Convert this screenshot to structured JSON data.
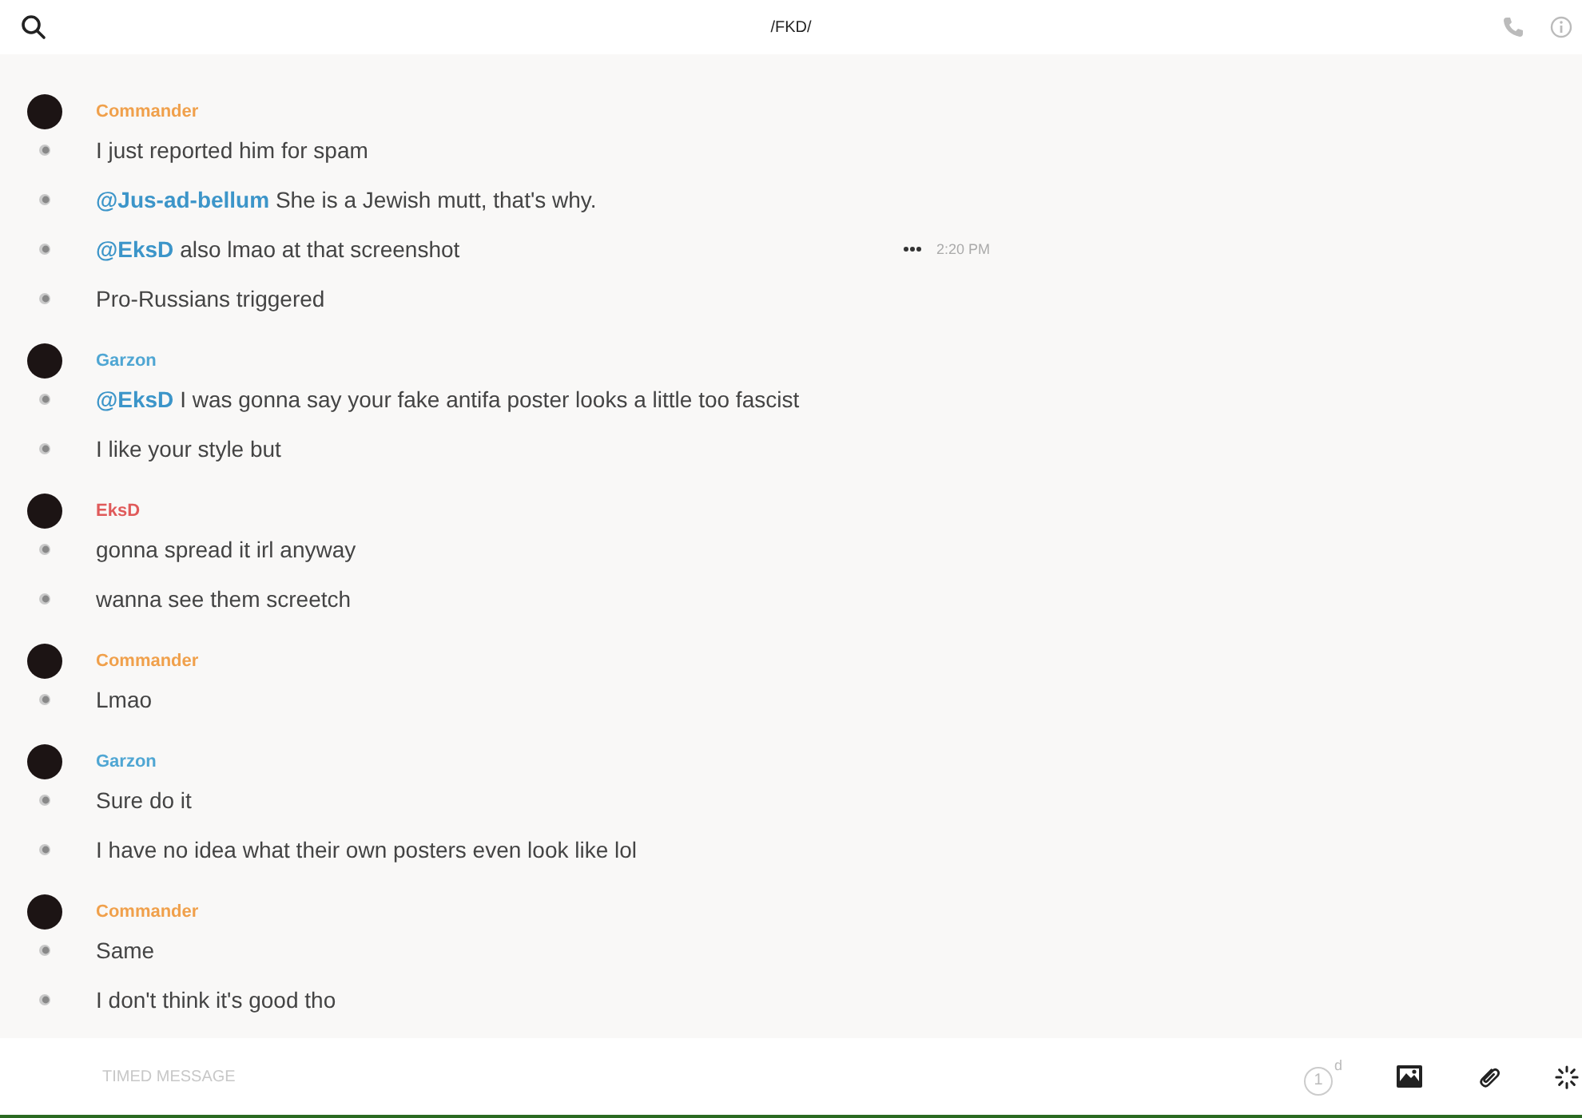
{
  "header": {
    "title": "/FKD/"
  },
  "groups": [
    {
      "author": "Commander",
      "color": "#f0a04b",
      "messages": [
        {
          "text": "I just reported him for spam"
        },
        {
          "mention": "@Jus-ad-bellum",
          "text": "She is a Jewish mutt, that's why."
        },
        {
          "mention": "@EksD",
          "text": "also lmao at that screenshot",
          "time": "2:20 PM"
        },
        {
          "text": "Pro-Russians triggered"
        }
      ]
    },
    {
      "author": "Garzon",
      "color": "#4fa6d3",
      "messages": [
        {
          "mention": "@EksD",
          "text": "I was gonna say your fake antifa poster looks a little too fascist"
        },
        {
          "text": "I like your style but"
        }
      ]
    },
    {
      "author": "EksD",
      "color": "#e05a5a",
      "messages": [
        {
          "text": "gonna spread it irl anyway"
        },
        {
          "text": "wanna see them screetch"
        }
      ]
    },
    {
      "author": "Commander",
      "color": "#f0a04b",
      "messages": [
        {
          "text": "Lmao"
        }
      ]
    },
    {
      "author": "Garzon",
      "color": "#4fa6d3",
      "messages": [
        {
          "text": "Sure do it"
        },
        {
          "text": "I have no idea what their own posters even look like lol"
        }
      ]
    },
    {
      "author": "Commander",
      "color": "#f0a04b",
      "messages": [
        {
          "text": "Same"
        },
        {
          "text": "I don't think it's good tho"
        }
      ]
    }
  ],
  "composer": {
    "placeholder": "TIMED MESSAGE",
    "timer": {
      "value": "1",
      "unit": "d"
    }
  }
}
